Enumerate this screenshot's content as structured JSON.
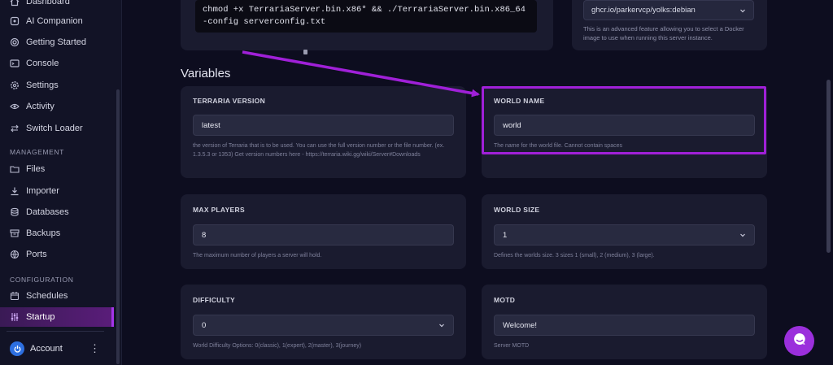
{
  "sidebar": {
    "top_items": [
      {
        "label": "Dashboard",
        "icon": "home-icon"
      },
      {
        "label": "AI Companion",
        "icon": "sparkle-icon"
      },
      {
        "label": "Getting Started",
        "icon": "lifebuoy-icon"
      },
      {
        "label": "Console",
        "icon": "terminal-icon"
      },
      {
        "label": "Settings",
        "icon": "gear-icon"
      },
      {
        "label": "Activity",
        "icon": "eye-icon"
      },
      {
        "label": "Switch Loader",
        "icon": "swap-icon"
      }
    ],
    "management_header": "MANAGEMENT",
    "management_items": [
      {
        "label": "Files",
        "icon": "folder-icon"
      },
      {
        "label": "Importer",
        "icon": "download-icon"
      },
      {
        "label": "Databases",
        "icon": "database-icon"
      },
      {
        "label": "Backups",
        "icon": "archive-icon"
      },
      {
        "label": "Ports",
        "icon": "network-icon"
      }
    ],
    "configuration_header": "CONFIGURATION",
    "configuration_items": [
      {
        "label": "Schedules",
        "icon": "calendar-icon"
      },
      {
        "label": "Startup",
        "icon": "sliders-icon",
        "active": true
      }
    ],
    "account_label": "Account"
  },
  "startup": {
    "command": "chmod +x TerrariaServer.bin.x86* && ./TerrariaServer.bin.x86_64 -config serverconfig.txt",
    "docker_image": "ghcr.io/parkervcp/yolks:debian",
    "docker_help": "This is an advanced feature allowing you to select a Docker image to use when running this server instance."
  },
  "variables_title": "Variables",
  "variables": [
    {
      "name": "TERRARIA VERSION",
      "value": "latest",
      "help": "the version of Terraria that is to be used. You can use the full version number or the file number. (ex. 1.3.5.3 or 1353) Get version numbers here - https://terraria.wiki.gg/wiki/Server#Downloads"
    },
    {
      "name": "WORLD NAME",
      "value": "world",
      "help": "The name for the world file. Cannot contain spaces"
    },
    {
      "name": "MAX PLAYERS",
      "value": "8",
      "help": "The maximum number of players a server will hold."
    },
    {
      "name": "WORLD SIZE",
      "value": "1",
      "help": "Defines the worlds size. 3 sizes 1 (small), 2 (medium), 3 (large)."
    },
    {
      "name": "DIFFICULTY",
      "value": "0",
      "help": "World Difficulty Options: 0(classic), 1(expert), 2(master), 3(journey)"
    },
    {
      "name": "MOTD",
      "value": "Welcome!",
      "help": "Server MOTD"
    }
  ],
  "colors": {
    "accent": "#a020d8",
    "active_nav": "#5a1d7a",
    "background": "#0d0d1f",
    "card": "#1a1b2f"
  }
}
